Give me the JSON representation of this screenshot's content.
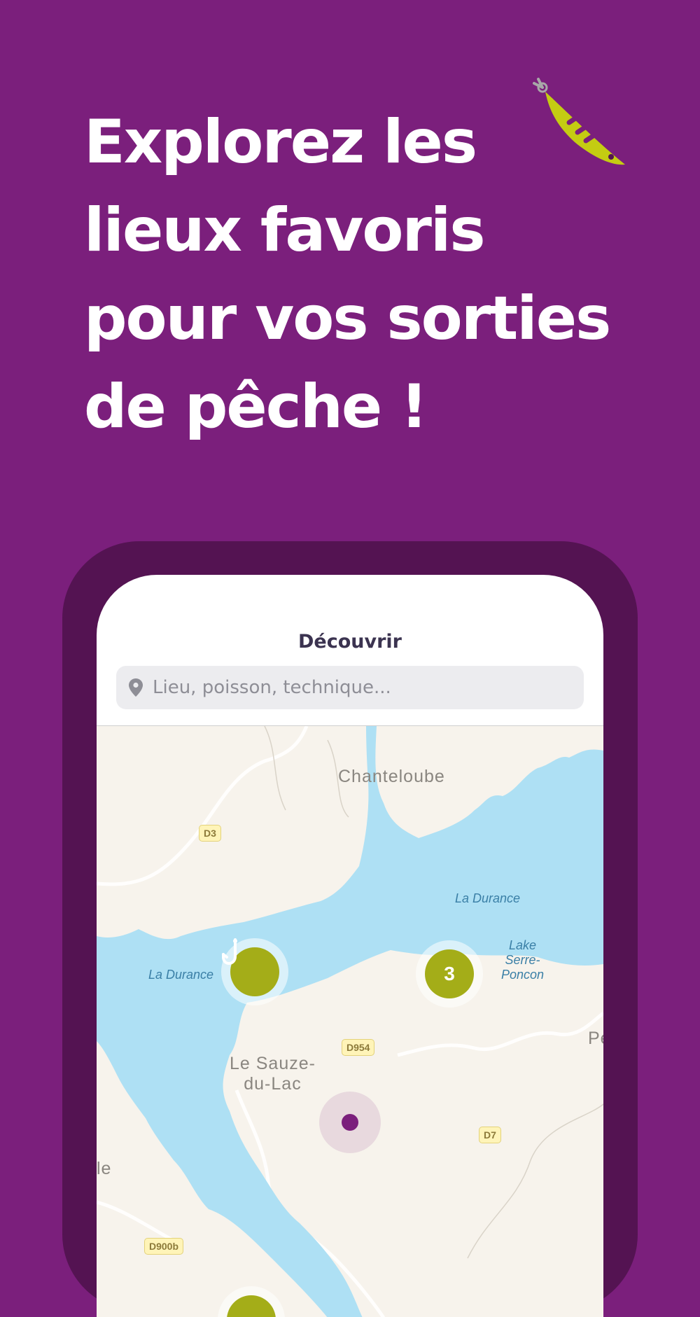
{
  "headline": {
    "lines": [
      "Explorez les",
      "lieux favoris",
      "pour vos sorties",
      "de pêche !"
    ]
  },
  "colors": {
    "background": "#7b1f7c",
    "phone_frame": "#541352",
    "accent": "#a4ad18",
    "water": "#aee0f4",
    "land": "#f7f3ec"
  },
  "app": {
    "screen_title": "Découvrir",
    "search": {
      "icon": "location-pin-icon",
      "placeholder": "Lieu, poisson, technique..."
    }
  },
  "map": {
    "town_labels": [
      "Chanteloube",
      "Le Sauze-\ndu-Lac",
      "Pe",
      "le"
    ],
    "water_labels": [
      "La Durance",
      "La Durance",
      "Lake\nSerre-\nPoncon"
    ],
    "road_labels": [
      "D3",
      "D954",
      "D7",
      "D900b"
    ],
    "markers": [
      {
        "type": "spot",
        "icon": "fishing-hook-icon"
      },
      {
        "type": "cluster",
        "count": "3"
      },
      {
        "type": "user-location",
        "icon": "location-dot-icon"
      }
    ]
  }
}
